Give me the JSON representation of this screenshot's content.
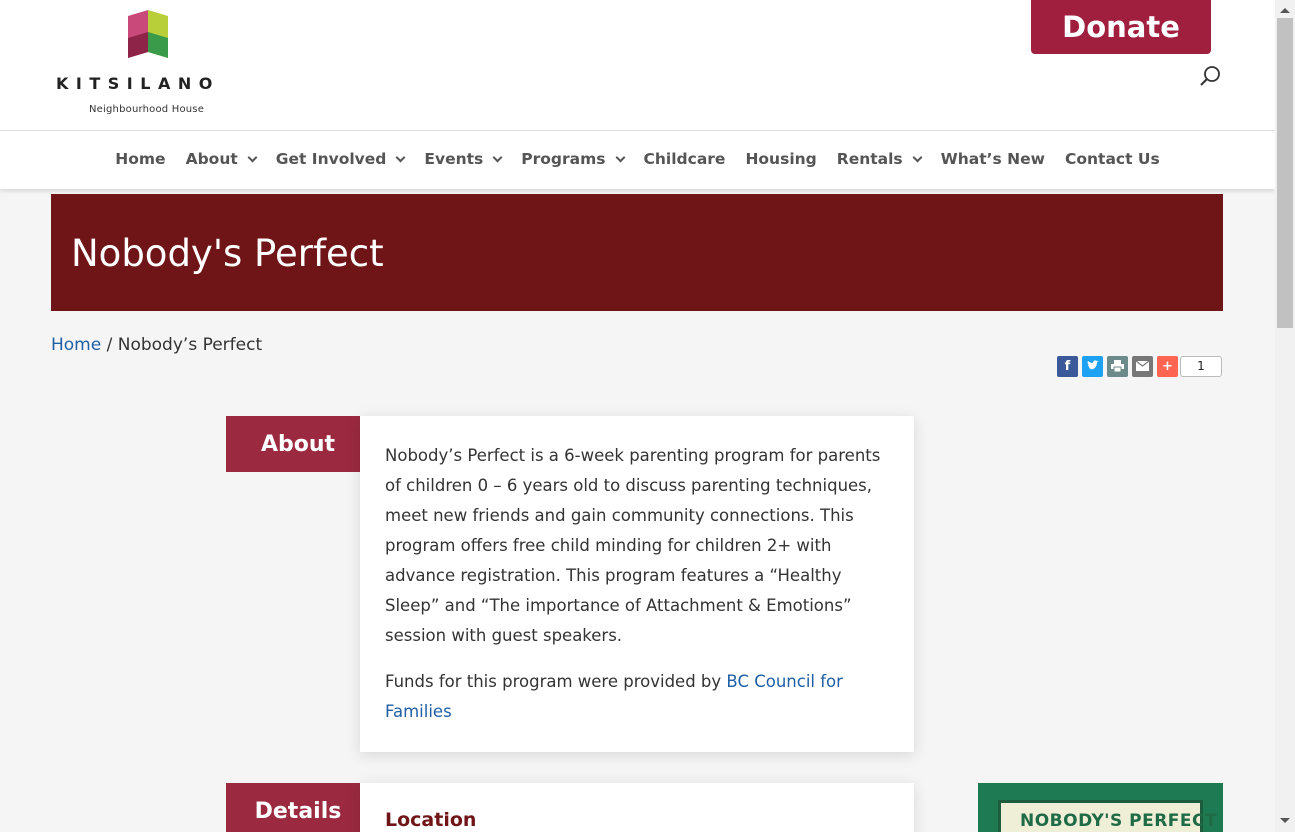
{
  "header": {
    "logo_word": "KITSILANO",
    "logo_sub": "Neighbourhood House",
    "donate_label": "Donate"
  },
  "nav": {
    "items": [
      {
        "label": "Home"
      },
      {
        "label": "About"
      },
      {
        "label": "Get Involved"
      },
      {
        "label": "Events"
      },
      {
        "label": "Programs"
      },
      {
        "label": "Childcare"
      },
      {
        "label": "Housing"
      },
      {
        "label": "Rentals"
      },
      {
        "label": "What’s New"
      },
      {
        "label": "Contact Us"
      }
    ]
  },
  "hero": {
    "title": "Nobody's Perfect"
  },
  "breadcrumb": {
    "home": "Home",
    "separator": "/",
    "current": "Nobody’s Perfect"
  },
  "share": {
    "count": "1"
  },
  "about": {
    "tab_label": "About",
    "paragraph1": "Nobody’s Perfect is a 6-week parenting program for parents of children 0 – 6 years old to discuss parenting techniques, meet new friends and gain community connections. This program offers free child minding for children 2+ with advance registration. This program features a “Healthy Sleep” and “The importance of Attachment & Emotions” session with guest speakers.",
    "funds_text": "Funds for this program were provided by ",
    "funds_link": "BC Council for Families"
  },
  "details": {
    "tab_label": "Details",
    "location_heading": "Location"
  },
  "poster": {
    "text": "NOBODY'S PERFECT"
  },
  "colors": {
    "brand": "#a01f3f",
    "hero": "#701517",
    "link": "#1f5fa6",
    "tab": "#9b2a40"
  }
}
